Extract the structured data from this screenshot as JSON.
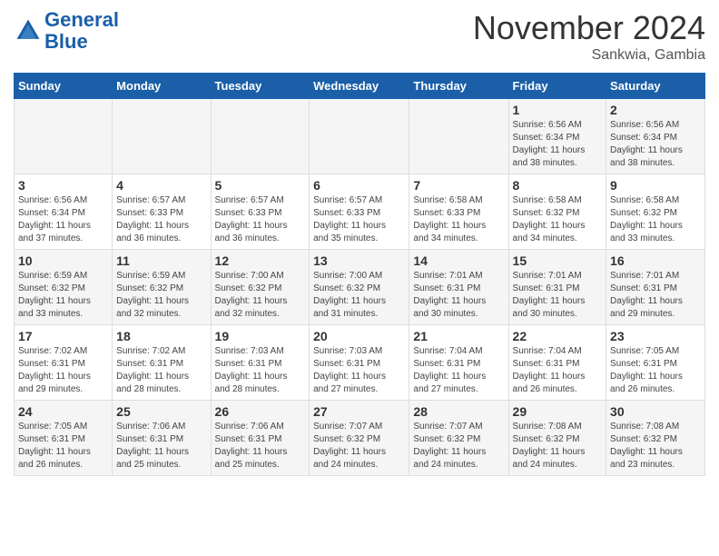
{
  "header": {
    "logo_line1": "General",
    "logo_line2": "Blue",
    "month": "November 2024",
    "location": "Sankwia, Gambia"
  },
  "days_of_week": [
    "Sunday",
    "Monday",
    "Tuesday",
    "Wednesday",
    "Thursday",
    "Friday",
    "Saturday"
  ],
  "weeks": [
    [
      {
        "day": "",
        "info": ""
      },
      {
        "day": "",
        "info": ""
      },
      {
        "day": "",
        "info": ""
      },
      {
        "day": "",
        "info": ""
      },
      {
        "day": "",
        "info": ""
      },
      {
        "day": "1",
        "info": "Sunrise: 6:56 AM\nSunset: 6:34 PM\nDaylight: 11 hours\nand 38 minutes."
      },
      {
        "day": "2",
        "info": "Sunrise: 6:56 AM\nSunset: 6:34 PM\nDaylight: 11 hours\nand 38 minutes."
      }
    ],
    [
      {
        "day": "3",
        "info": "Sunrise: 6:56 AM\nSunset: 6:34 PM\nDaylight: 11 hours\nand 37 minutes."
      },
      {
        "day": "4",
        "info": "Sunrise: 6:57 AM\nSunset: 6:33 PM\nDaylight: 11 hours\nand 36 minutes."
      },
      {
        "day": "5",
        "info": "Sunrise: 6:57 AM\nSunset: 6:33 PM\nDaylight: 11 hours\nand 36 minutes."
      },
      {
        "day": "6",
        "info": "Sunrise: 6:57 AM\nSunset: 6:33 PM\nDaylight: 11 hours\nand 35 minutes."
      },
      {
        "day": "7",
        "info": "Sunrise: 6:58 AM\nSunset: 6:33 PM\nDaylight: 11 hours\nand 34 minutes."
      },
      {
        "day": "8",
        "info": "Sunrise: 6:58 AM\nSunset: 6:32 PM\nDaylight: 11 hours\nand 34 minutes."
      },
      {
        "day": "9",
        "info": "Sunrise: 6:58 AM\nSunset: 6:32 PM\nDaylight: 11 hours\nand 33 minutes."
      }
    ],
    [
      {
        "day": "10",
        "info": "Sunrise: 6:59 AM\nSunset: 6:32 PM\nDaylight: 11 hours\nand 33 minutes."
      },
      {
        "day": "11",
        "info": "Sunrise: 6:59 AM\nSunset: 6:32 PM\nDaylight: 11 hours\nand 32 minutes."
      },
      {
        "day": "12",
        "info": "Sunrise: 7:00 AM\nSunset: 6:32 PM\nDaylight: 11 hours\nand 32 minutes."
      },
      {
        "day": "13",
        "info": "Sunrise: 7:00 AM\nSunset: 6:32 PM\nDaylight: 11 hours\nand 31 minutes."
      },
      {
        "day": "14",
        "info": "Sunrise: 7:01 AM\nSunset: 6:31 PM\nDaylight: 11 hours\nand 30 minutes."
      },
      {
        "day": "15",
        "info": "Sunrise: 7:01 AM\nSunset: 6:31 PM\nDaylight: 11 hours\nand 30 minutes."
      },
      {
        "day": "16",
        "info": "Sunrise: 7:01 AM\nSunset: 6:31 PM\nDaylight: 11 hours\nand 29 minutes."
      }
    ],
    [
      {
        "day": "17",
        "info": "Sunrise: 7:02 AM\nSunset: 6:31 PM\nDaylight: 11 hours\nand 29 minutes."
      },
      {
        "day": "18",
        "info": "Sunrise: 7:02 AM\nSunset: 6:31 PM\nDaylight: 11 hours\nand 28 minutes."
      },
      {
        "day": "19",
        "info": "Sunrise: 7:03 AM\nSunset: 6:31 PM\nDaylight: 11 hours\nand 28 minutes."
      },
      {
        "day": "20",
        "info": "Sunrise: 7:03 AM\nSunset: 6:31 PM\nDaylight: 11 hours\nand 27 minutes."
      },
      {
        "day": "21",
        "info": "Sunrise: 7:04 AM\nSunset: 6:31 PM\nDaylight: 11 hours\nand 27 minutes."
      },
      {
        "day": "22",
        "info": "Sunrise: 7:04 AM\nSunset: 6:31 PM\nDaylight: 11 hours\nand 26 minutes."
      },
      {
        "day": "23",
        "info": "Sunrise: 7:05 AM\nSunset: 6:31 PM\nDaylight: 11 hours\nand 26 minutes."
      }
    ],
    [
      {
        "day": "24",
        "info": "Sunrise: 7:05 AM\nSunset: 6:31 PM\nDaylight: 11 hours\nand 26 minutes."
      },
      {
        "day": "25",
        "info": "Sunrise: 7:06 AM\nSunset: 6:31 PM\nDaylight: 11 hours\nand 25 minutes."
      },
      {
        "day": "26",
        "info": "Sunrise: 7:06 AM\nSunset: 6:31 PM\nDaylight: 11 hours\nand 25 minutes."
      },
      {
        "day": "27",
        "info": "Sunrise: 7:07 AM\nSunset: 6:32 PM\nDaylight: 11 hours\nand 24 minutes."
      },
      {
        "day": "28",
        "info": "Sunrise: 7:07 AM\nSunset: 6:32 PM\nDaylight: 11 hours\nand 24 minutes."
      },
      {
        "day": "29",
        "info": "Sunrise: 7:08 AM\nSunset: 6:32 PM\nDaylight: 11 hours\nand 24 minutes."
      },
      {
        "day": "30",
        "info": "Sunrise: 7:08 AM\nSunset: 6:32 PM\nDaylight: 11 hours\nand 23 minutes."
      }
    ]
  ]
}
